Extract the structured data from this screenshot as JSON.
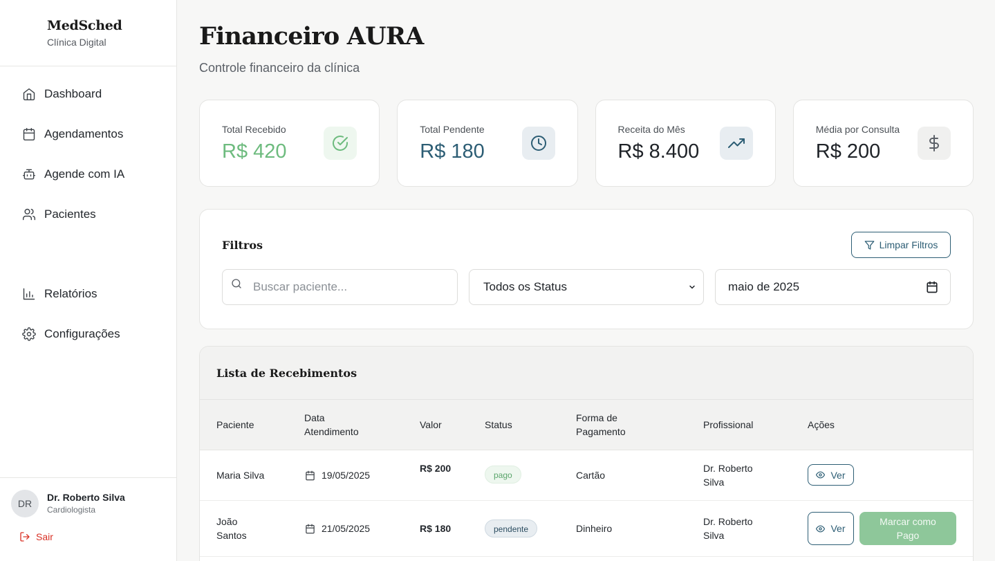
{
  "brand": {
    "name": "MedSched",
    "subtitle": "Clínica Digital"
  },
  "nav": [
    {
      "label": "Dashboard",
      "icon": "home-icon"
    },
    {
      "label": "Agendamentos",
      "icon": "calendar-icon"
    },
    {
      "label": "Agende com IA",
      "icon": "bot-icon"
    },
    {
      "label": "Pacientes",
      "icon": "users-icon"
    },
    {
      "label": "Relatórios",
      "icon": "bar-chart-icon"
    },
    {
      "label": "Configurações",
      "icon": "gear-icon"
    }
  ],
  "user": {
    "initials": "DR",
    "name": "Dr. Roberto Silva",
    "role": "Cardiologista",
    "logout_label": "Sair"
  },
  "page": {
    "title": "Financeiro AURA",
    "subtitle": "Controle financeiro da clínica"
  },
  "stats": [
    {
      "label": "Total Recebido",
      "value": "R$ 420",
      "icon": "check-circle-icon",
      "color": "#6dbb7e",
      "icon_bg": "#eef7ef"
    },
    {
      "label": "Total Pendente",
      "value": "R$ 180",
      "icon": "clock-icon",
      "color": "#2c5d74",
      "icon_bg": "#e8edf1"
    },
    {
      "label": "Receita do Mês",
      "value": "R$ 8.400",
      "icon": "trending-up-icon",
      "color": "#1f2328",
      "icon_bg": "#e8edf1"
    },
    {
      "label": "Média por Consulta",
      "value": "R$ 200",
      "icon": "dollar-icon",
      "color": "#1f2328",
      "icon_bg": "#f0f0ef"
    }
  ],
  "filters": {
    "title": "Filtros",
    "clear_label": "Limpar Filtros",
    "search_placeholder": "Buscar paciente...",
    "status_value": "Todos os Status",
    "month_value": "maio de 2025"
  },
  "list": {
    "title": "Lista de Recebimentos",
    "columns": [
      "Paciente",
      "Data Atendimento",
      "Valor",
      "Status",
      "Forma de Pagamento",
      "Profissional",
      "Ações"
    ],
    "rows": [
      {
        "patient": "Maria Silva",
        "date": "19/05/2025",
        "value": "R$ 200",
        "status": "pago",
        "payment": "Cartão",
        "professional": "Dr. Roberto Silva",
        "view_label": "Ver"
      },
      {
        "patient": "João Santos",
        "date": "21/05/2025",
        "value": "R$ 180",
        "status": "pendente",
        "payment": "Dinheiro",
        "professional": "Dr. Roberto Silva",
        "view_label": "Ver",
        "mark_paid_label": "Marcar como Pago"
      }
    ]
  },
  "colors": {
    "accent": "#2c5d74",
    "success": "#6dbb7e",
    "danger": "#d93025"
  }
}
